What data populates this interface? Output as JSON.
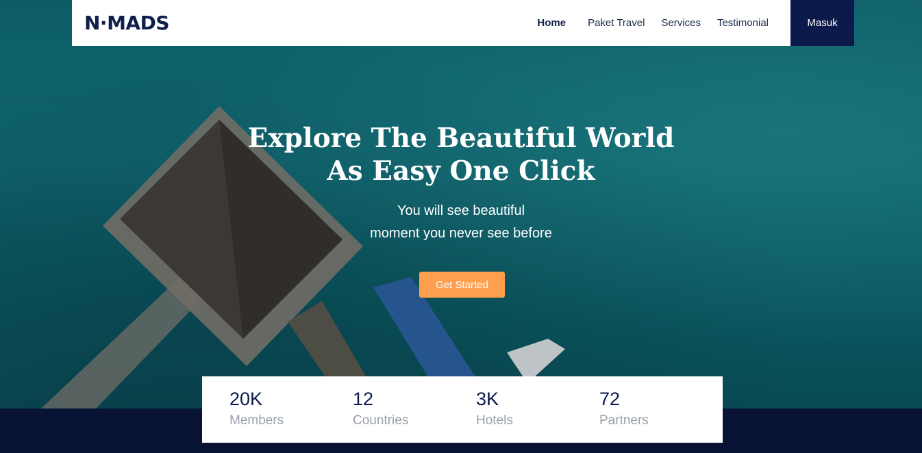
{
  "brand": {
    "name": "N·MADS"
  },
  "nav": {
    "links": [
      "Home",
      "Paket Travel",
      "Services",
      "Testimonial"
    ],
    "login": "Masuk"
  },
  "hero": {
    "title_line1": "Explore The Beautiful World",
    "title_line2": "As Easy One Click",
    "subtitle_line1": "You will see beautiful",
    "subtitle_line2": "moment you never see before",
    "cta": "Get Started"
  },
  "stats": [
    {
      "value": "20K",
      "label": "Members"
    },
    {
      "value": "12",
      "label": "Countries"
    },
    {
      "value": "3K",
      "label": "Hotels"
    },
    {
      "value": "72",
      "label": "Partners"
    }
  ],
  "colors": {
    "navy": "#0b1a4a",
    "accent": "#ff9f4e",
    "sea": "#137883"
  }
}
